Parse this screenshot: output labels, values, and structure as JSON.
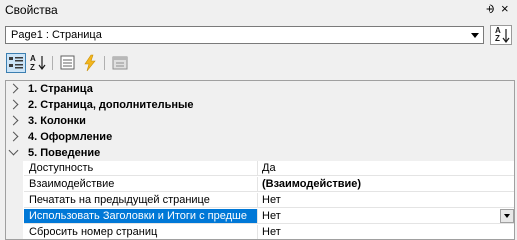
{
  "panel": {
    "title": "Свойства",
    "pin_glyph": "⨮",
    "close_glyph": "×"
  },
  "object_selector": {
    "value": "Page1 : Страница"
  },
  "toolbar": {
    "buttons": [
      {
        "icon": "categorized-icon",
        "active": true
      },
      {
        "icon": "alphabetical-sort-icon"
      },
      {
        "icon": "properties-page-icon"
      },
      {
        "icon": "events-icon"
      },
      {
        "icon": "property-pages-icon"
      }
    ],
    "sort_icon": {
      "top": "A",
      "bottom": "Z"
    }
  },
  "grid": {
    "categories": [
      {
        "label": "1. Страница",
        "expanded": false
      },
      {
        "label": "2. Страница, дополнительные",
        "expanded": false
      },
      {
        "label": "3. Колонки",
        "expanded": false
      },
      {
        "label": "4. Оформление",
        "expanded": false
      },
      {
        "label": "5. Поведение",
        "expanded": true
      }
    ],
    "properties": [
      {
        "name": "Доступность",
        "value": "Да"
      },
      {
        "name": "Взаимодействие",
        "value": "(Взаимодействие)",
        "bold": true
      },
      {
        "name": "Печатать на предыдущей странице",
        "value": "Нет"
      },
      {
        "name": "Использовать Заголовки и Итоги с предше",
        "value": "Нет",
        "selected": true
      },
      {
        "name": "Сбросить номер страниц",
        "value": "Нет"
      }
    ]
  },
  "colors": {
    "selection": "#0078d7",
    "category_bg": "#f0f0f0",
    "active_button": "#cce4f7"
  }
}
